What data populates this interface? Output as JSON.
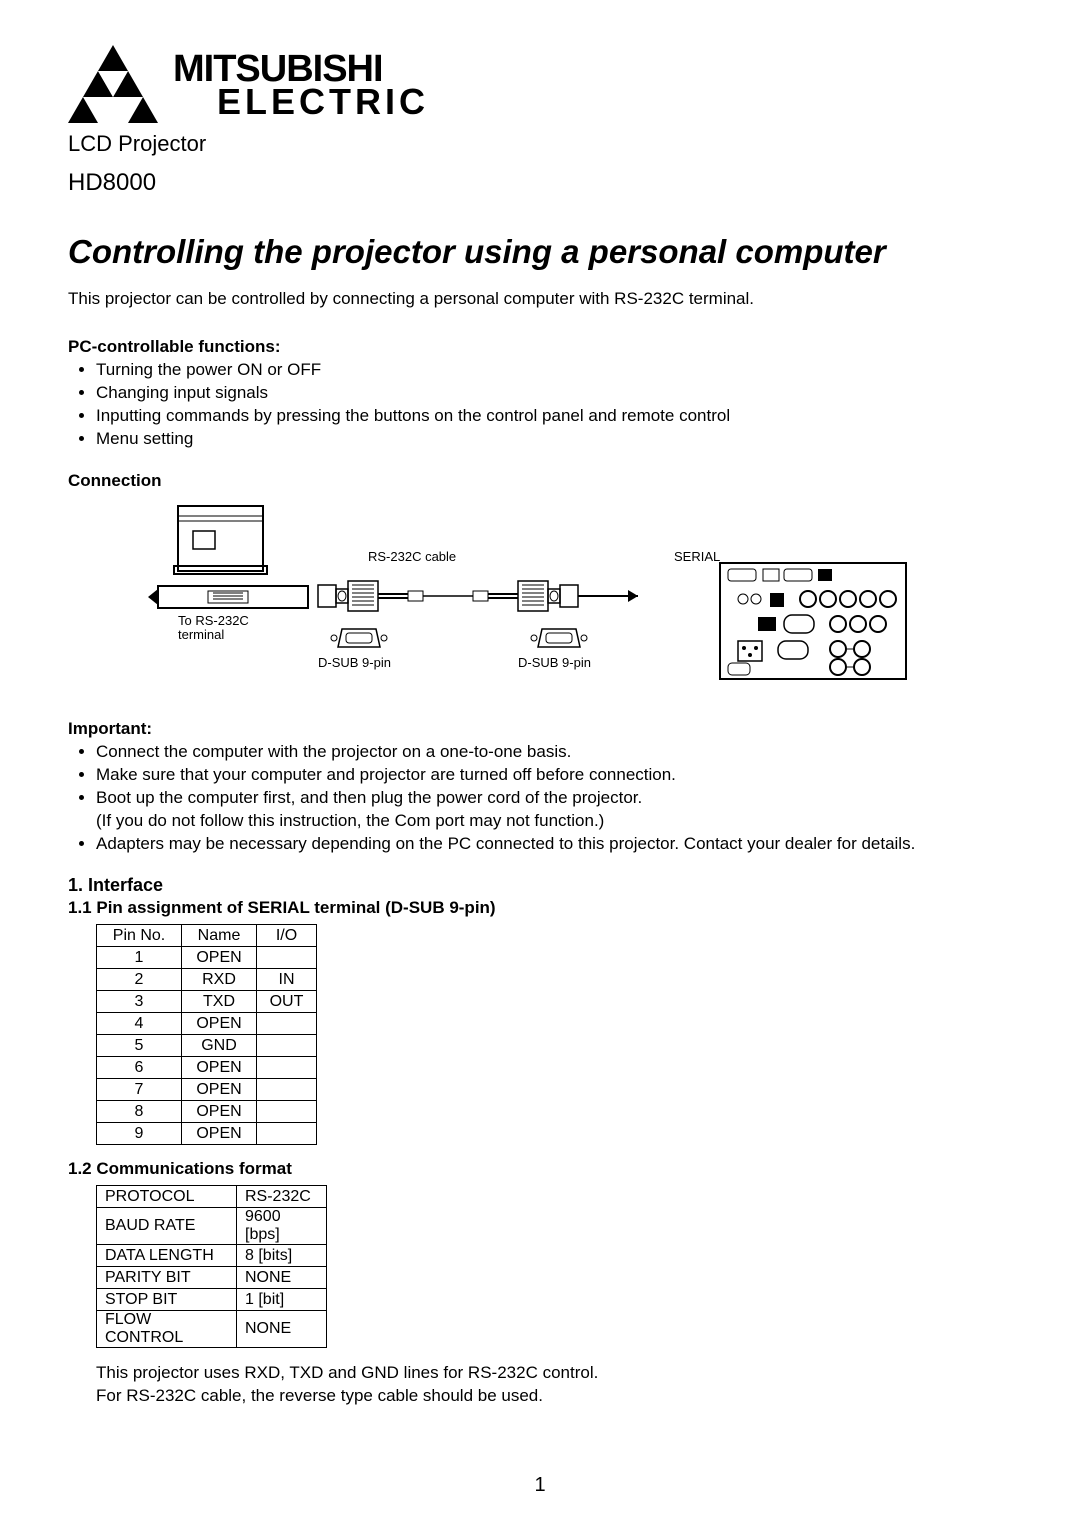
{
  "logo": {
    "brand": "MITSUBISHI",
    "brand2": "ELECTRIC"
  },
  "header": {
    "subtitle": "LCD Projector",
    "model": "HD8000"
  },
  "title": "Controlling the projector using a personal computer",
  "intro": "This projector can be controlled by connecting a personal computer with RS-232C terminal.",
  "pcFunctions": {
    "heading": "PC-controllable functions:",
    "items": [
      "Turning the power ON or OFF",
      "Changing input signals",
      "Inputting commands by pressing the buttons on the control panel and remote control",
      "Menu setting"
    ]
  },
  "connection": {
    "heading": "Connection"
  },
  "diagram": {
    "cable": "RS-232C cable",
    "serial": "SERIAL",
    "toTerm1": "To RS-232C",
    "toTerm2": "terminal",
    "dsub1": "D-SUB 9-pin",
    "dsub2": "D-SUB 9-pin"
  },
  "important": {
    "heading": "Important:",
    "items": [
      "Connect the computer with the projector on a one-to-one basis.",
      "Make sure that your computer and projector are turned off before connection.",
      "Boot up the computer first, and then plug the power cord of the projector.",
      "Adapters may be necessary depending on the PC connected to this projector. Contact your dealer for details."
    ],
    "subNote": "(If you do not follow this instruction, the Com port may not function.)"
  },
  "interface": {
    "heading": "1.  Interface",
    "sub1": "1.1  Pin assignment of SERIAL terminal (D-SUB 9-pin)",
    "sub2": "1.2  Communications format"
  },
  "table1": {
    "headers": [
      "Pin No.",
      "Name",
      "I/O"
    ],
    "rows": [
      [
        "1",
        "OPEN",
        ""
      ],
      [
        "2",
        "RXD",
        "IN"
      ],
      [
        "3",
        "TXD",
        "OUT"
      ],
      [
        "4",
        "OPEN",
        ""
      ],
      [
        "5",
        "GND",
        ""
      ],
      [
        "6",
        "OPEN",
        ""
      ],
      [
        "7",
        "OPEN",
        ""
      ],
      [
        "8",
        "OPEN",
        ""
      ],
      [
        "9",
        "OPEN",
        ""
      ]
    ]
  },
  "table2": {
    "rows": [
      [
        "PROTOCOL",
        "RS-232C"
      ],
      [
        "BAUD RATE",
        "9600 [bps]"
      ],
      [
        "DATA LENGTH",
        "8 [bits]"
      ],
      [
        "PARITY BIT",
        "NONE"
      ],
      [
        "STOP BIT",
        "1 [bit]"
      ],
      [
        "FLOW CONTROL",
        "NONE"
      ]
    ]
  },
  "notes": {
    "l1": "This projector uses RXD, TXD and GND lines for RS-232C control.",
    "l2": "For RS-232C cable, the reverse type cable should be used."
  },
  "pageNum": "1"
}
